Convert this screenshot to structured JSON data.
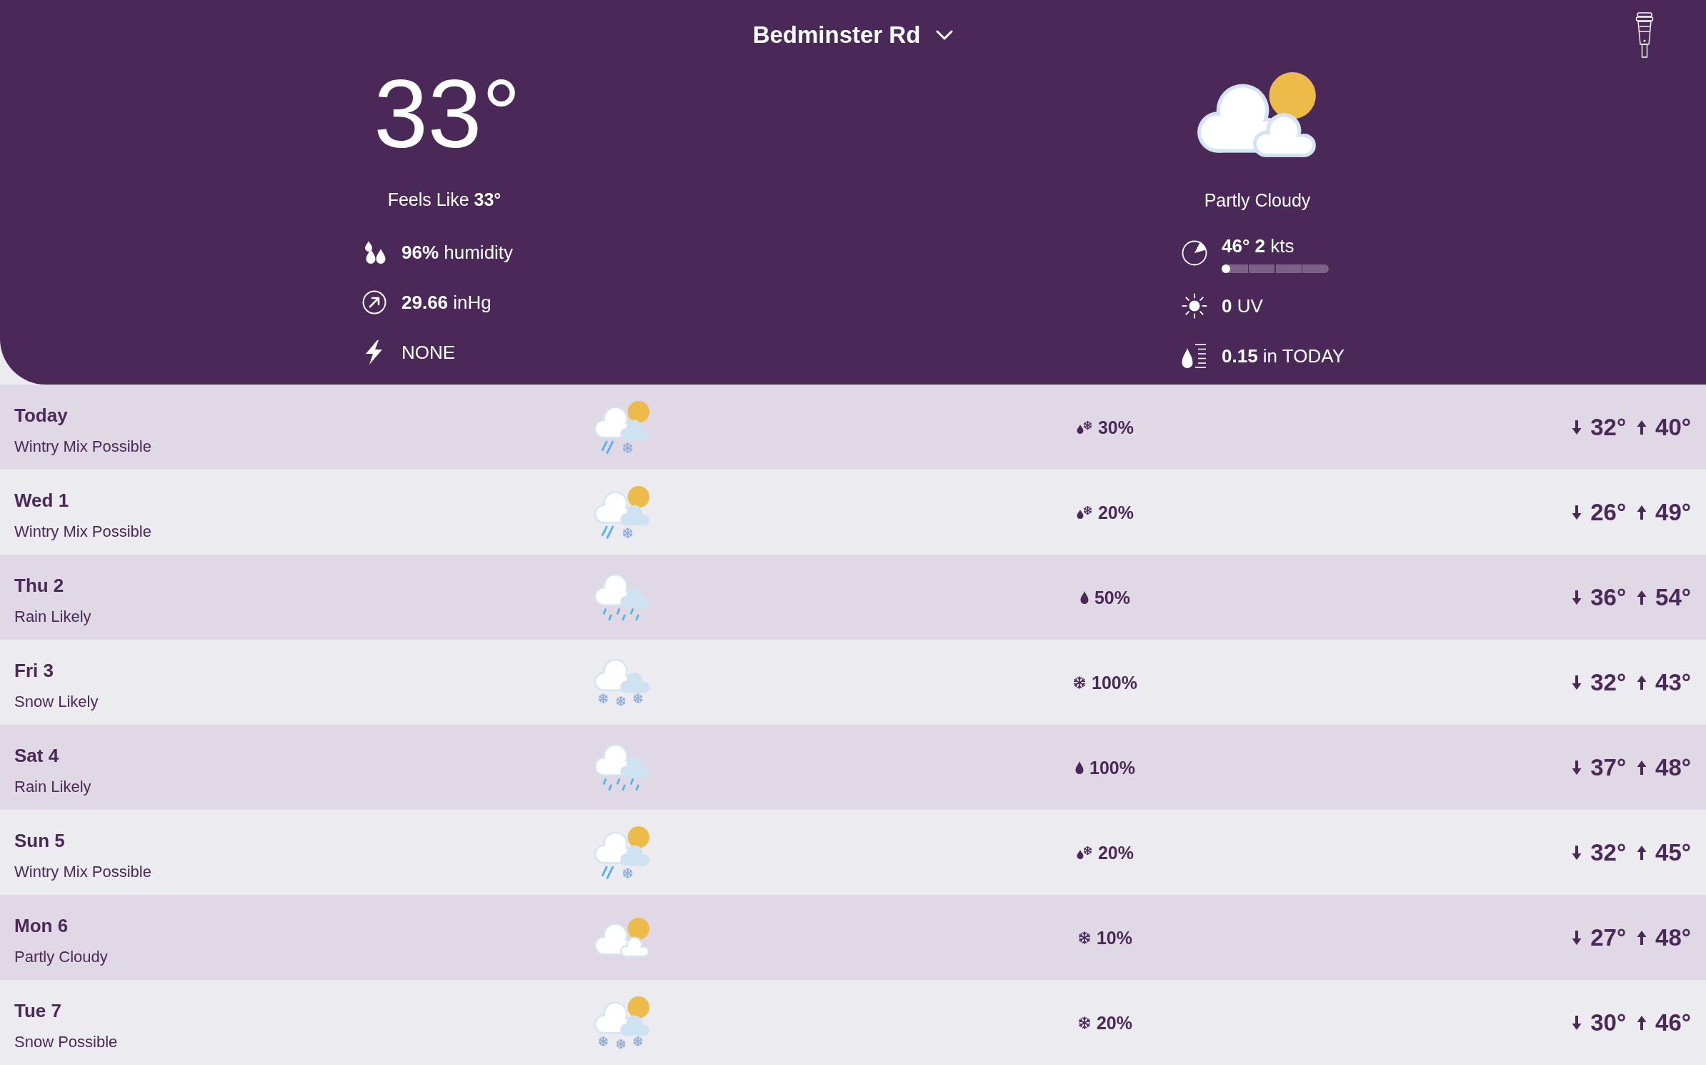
{
  "header": {
    "location": "Bedminster Rd"
  },
  "current": {
    "temperature": "33°",
    "feels_like": "Feels Like **33°**",
    "condition": {
      "kind": "partly_cloudy",
      "label": "Partly Cloudy"
    },
    "left_stats": [
      {
        "kind": "humidity",
        "text": "**96%** humidity"
      },
      {
        "kind": "pressure",
        "text": "**29.66** inHg"
      },
      {
        "kind": "lightning",
        "text": "NONE"
      }
    ],
    "right_stats": [
      {
        "kind": "wind",
        "text": "**46° 2** kts",
        "level": 0.04
      },
      {
        "kind": "uv",
        "text": "**0** UV"
      },
      {
        "kind": "rain",
        "text": "**0.15** in TODAY"
      }
    ]
  },
  "forecast": [
    {
      "day": "Today",
      "summary": "Wintry Mix Possible",
      "icon": {
        "kind": "mix_sun"
      },
      "precip": {
        "kind": "mix",
        "chance": "30%"
      },
      "low": "32°",
      "high": "40°"
    },
    {
      "day": "Wed 1",
      "summary": "Wintry Mix Possible",
      "icon": {
        "kind": "mix_sun"
      },
      "precip": {
        "kind": "mix",
        "chance": "20%"
      },
      "low": "26°",
      "high": "49°"
    },
    {
      "day": "Thu 2",
      "summary": "Rain Likely",
      "icon": {
        "kind": "rain"
      },
      "precip": {
        "kind": "rain",
        "chance": "50%"
      },
      "low": "36°",
      "high": "54°"
    },
    {
      "day": "Fri 3",
      "summary": "Snow Likely",
      "icon": {
        "kind": "snow"
      },
      "precip": {
        "kind": "snow",
        "chance": "100%"
      },
      "low": "32°",
      "high": "43°"
    },
    {
      "day": "Sat 4",
      "summary": "Rain Likely",
      "icon": {
        "kind": "rain"
      },
      "precip": {
        "kind": "rain",
        "chance": "100%"
      },
      "low": "37°",
      "high": "48°"
    },
    {
      "day": "Sun 5",
      "summary": "Wintry Mix Possible",
      "icon": {
        "kind": "mix_sun"
      },
      "precip": {
        "kind": "mix",
        "chance": "20%"
      },
      "low": "32°",
      "high": "45°"
    },
    {
      "day": "Mon 6",
      "summary": "Partly Cloudy",
      "icon": {
        "kind": "partly_cloudy"
      },
      "precip": {
        "kind": "snow",
        "chance": "10%"
      },
      "low": "27°",
      "high": "48°"
    },
    {
      "day": "Tue 7",
      "summary": "Snow Possible",
      "icon": {
        "kind": "snow_sun"
      },
      "precip": {
        "kind": "snow",
        "chance": "20%"
      },
      "low": "30°",
      "high": "46°"
    }
  ]
}
